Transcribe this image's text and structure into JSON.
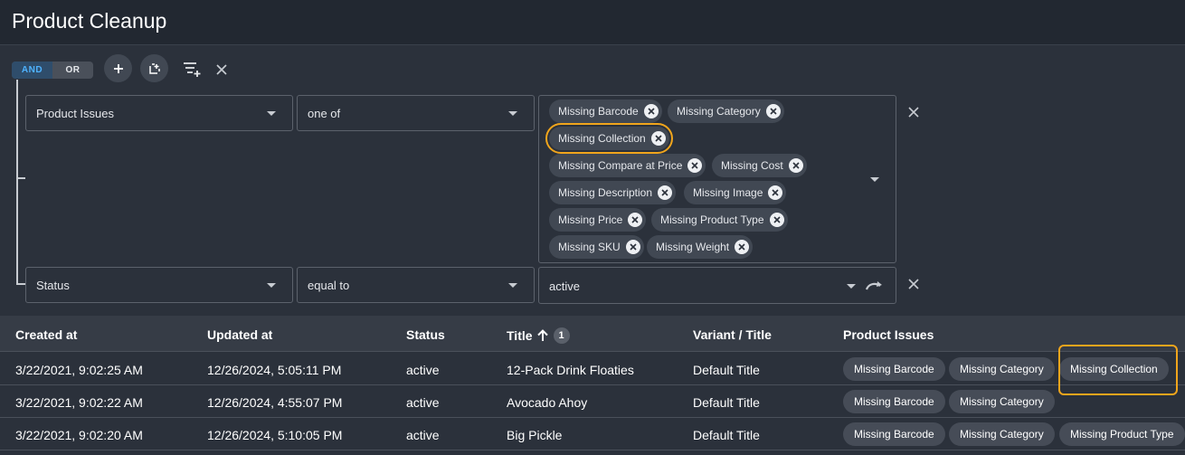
{
  "app": {
    "title": "Product Cleanup"
  },
  "toolbar": {
    "and_label": "AND",
    "or_label": "OR",
    "selected_logic": "AND"
  },
  "filters": [
    {
      "field": "Product Issues",
      "operator": "one of",
      "values": [
        "Missing Barcode",
        "Missing Category",
        "Missing Collection",
        "Missing Compare at Price",
        "Missing Cost",
        "Missing Description",
        "Missing Image",
        "Missing Price",
        "Missing Product Type",
        "Missing SKU",
        "Missing Weight"
      ],
      "highlighted_value": "Missing Collection"
    },
    {
      "field": "Status",
      "operator": "equal to",
      "value": "active"
    }
  ],
  "table": {
    "columns": [
      "Created at",
      "Updated at",
      "Status",
      "Title",
      "Variant / Title",
      "Product Issues"
    ],
    "sort_rank": "1",
    "rows": [
      {
        "created": "3/22/2021, 9:02:25 AM",
        "updated": "12/26/2024, 5:05:11 PM",
        "status": "active",
        "title": "12-Pack Drink Floaties",
        "variant": "Default Title",
        "issues": [
          "Missing Barcode",
          "Missing Category",
          "Missing Collection"
        ]
      },
      {
        "created": "3/22/2021, 9:02:22 AM",
        "updated": "12/26/2024, 4:55:07 PM",
        "status": "active",
        "title": "Avocado Ahoy",
        "variant": "Default Title",
        "issues": [
          "Missing Barcode",
          "Missing Category"
        ]
      },
      {
        "created": "3/22/2021, 9:02:20 AM",
        "updated": "12/26/2024, 5:10:05 PM",
        "status": "active",
        "title": "Big Pickle",
        "variant": "Default Title",
        "issues": [
          "Missing Barcode",
          "Missing Category",
          "Missing Product Type"
        ]
      }
    ]
  },
  "colors": {
    "highlight": "#f0a51c",
    "accent": "#4fb3ff",
    "background": "#2b313b"
  }
}
